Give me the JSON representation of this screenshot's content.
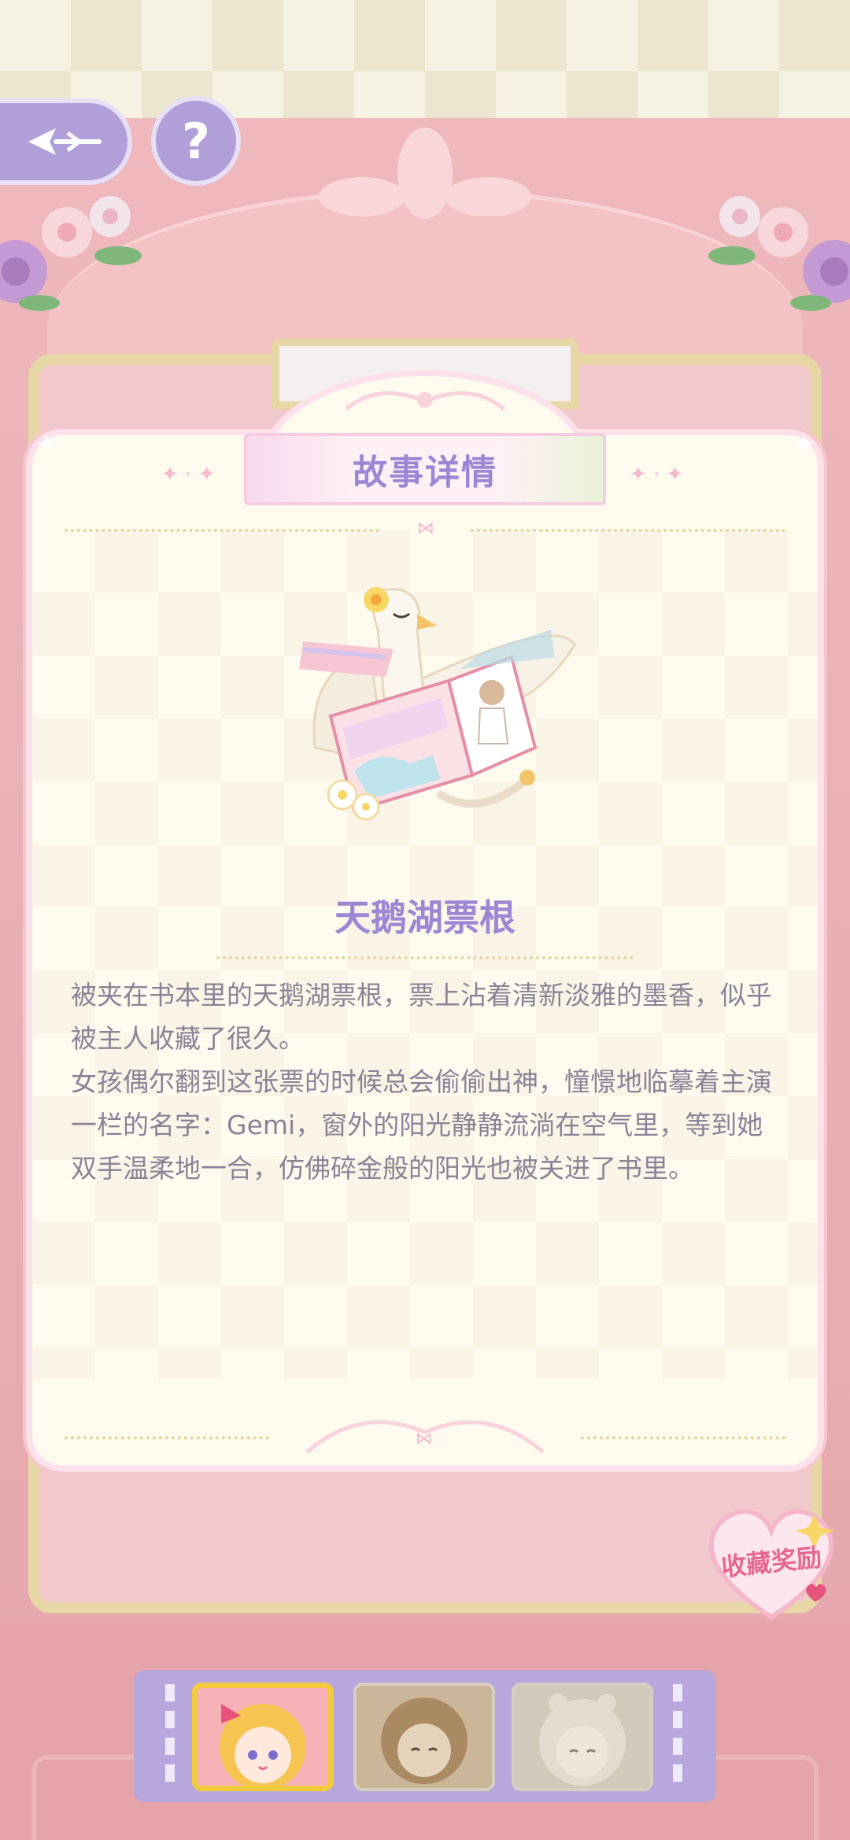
{
  "header": {
    "back_label": "back",
    "help_label": "?"
  },
  "card": {
    "title": "故事详情",
    "item_name": "天鹅湖票根",
    "description": [
      "被夹在书本里的天鹅湖票根，票上沾着清新淡雅的墨香，似乎被主人收藏了很久。",
      "女孩偶尔翻到这张票的时候总会偷偷出神，憧憬地临摹着主演一栏的名字：Gemi，窗外的阳光静静流淌在空气里，等到她双手温柔地一合，仿佛碎金般的阳光也被关进了书里。"
    ]
  },
  "reward": {
    "label": "收藏奖励"
  },
  "characters": [
    {
      "name": "character-1",
      "selected": true
    },
    {
      "name": "character-2",
      "selected": false
    },
    {
      "name": "character-3",
      "selected": false
    }
  ],
  "colors": {
    "accent_purple": "#9d86d4",
    "card_bg": "#fffaee",
    "wardrobe_pink": "#eeb8bc",
    "reward_pink": "#e56891",
    "selected_gold": "#f3cb3e"
  }
}
